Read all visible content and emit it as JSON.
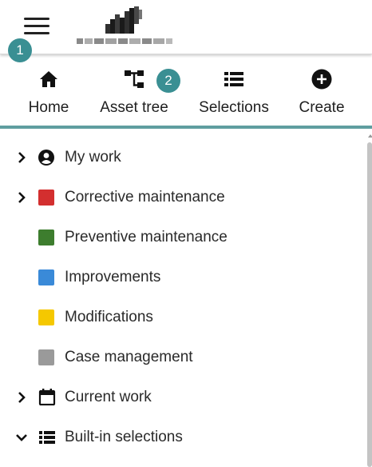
{
  "header": {
    "menu_icon": "hamburger-menu-icon",
    "logo_icon": "company-logo",
    "step_badges": [
      "1",
      "2"
    ]
  },
  "nav": {
    "accent_color": "#5f9ea0",
    "items": [
      {
        "label": "Home",
        "icon": "home-icon"
      },
      {
        "label": "Asset tree",
        "icon": "asset-tree-icon"
      },
      {
        "label": "Selections",
        "icon": "list-icon"
      },
      {
        "label": "Create",
        "icon": "add-circle-icon"
      }
    ]
  },
  "menu": {
    "items": [
      {
        "label": "My work",
        "expander": "chevron-right-icon",
        "icon": "account-circle-icon"
      },
      {
        "label": "Corrective maintenance",
        "expander": "chevron-right-icon",
        "color": "#d32f2f"
      },
      {
        "label": "Preventive maintenance",
        "color": "#3d7d2e"
      },
      {
        "label": "Improvements",
        "color": "#3a8ad8"
      },
      {
        "label": "Modifications",
        "color": "#f5c800"
      },
      {
        "label": "Case management",
        "color": "#9a9a9a"
      },
      {
        "label": "Current work",
        "expander": "chevron-right-icon",
        "icon": "calendar-icon"
      },
      {
        "label": "Built-in selections",
        "expander": "chevron-down-icon",
        "icon": "list-icon"
      }
    ]
  }
}
